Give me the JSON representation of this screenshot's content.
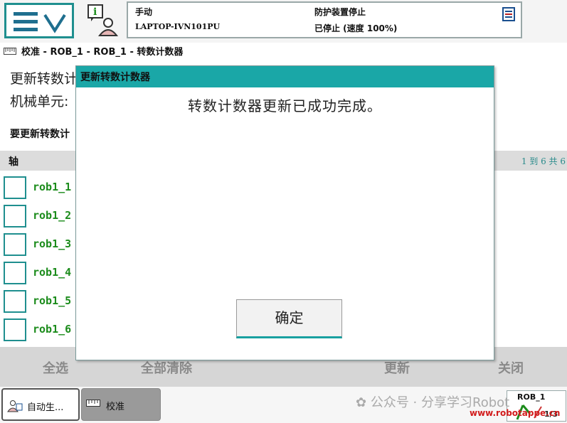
{
  "header": {
    "mode": "手动",
    "host": "LAPTOP-IVN101PU",
    "guard_state": "防护装置停止",
    "run_state": "已停止 (速度 100%)",
    "menu_icon": "hamburger-chevron-icon",
    "info_icon": "operator-info-icon"
  },
  "breadcrumb": {
    "text": "校准 - ROB_1 - ROB_1 - 转数计数器",
    "icon": "calibration-icon"
  },
  "page": {
    "title": "更新转数计",
    "mech_label": "机械单元:",
    "update_hint": "要更新转数计",
    "table": {
      "header_axis": "轴",
      "page_info": "1 到 6 共 6",
      "rows": [
        "rob1_1",
        "rob1_2",
        "rob1_3",
        "rob1_4",
        "rob1_5",
        "rob1_6"
      ]
    }
  },
  "commands": {
    "select_all": "全选",
    "clear_all": "全部清除",
    "update": "更新",
    "close": "关闭"
  },
  "dialog": {
    "title": "更新转数计数器",
    "message": "转数计数器更新已成功完成。",
    "ok_label": "确定"
  },
  "taskbar": {
    "task1": "自动生...",
    "task2": "校准",
    "robot_label": "ROB_1",
    "robot_fraction": "1/3"
  },
  "watermark": {
    "text": "公众号 · 分享学习Robot",
    "site": "www.robotappe.cn"
  },
  "colors": {
    "accent": "#1aa7a7",
    "row_text": "#1c8c1c",
    "cmd_bar": "#d6d6d6"
  }
}
